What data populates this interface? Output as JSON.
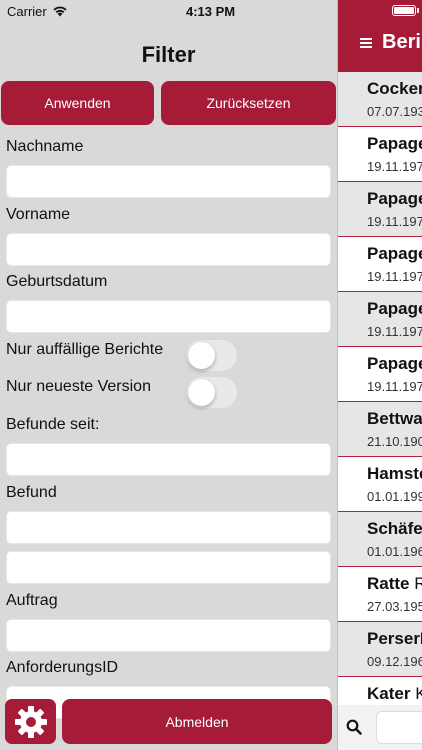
{
  "status_bar": {
    "carrier": "Carrier",
    "time": "4:13 PM"
  },
  "filter": {
    "title": "Filter",
    "apply_label": "Anwenden",
    "reset_label": "Zurücksetzen",
    "fields": {
      "nachname": {
        "label": "Nachname",
        "value": ""
      },
      "vorname": {
        "label": "Vorname",
        "value": ""
      },
      "geburtsdatum": {
        "label": "Geburtsdatum",
        "value": ""
      },
      "befunde_seit": {
        "label": "Befunde seit:",
        "value": ""
      },
      "befund": {
        "label": "Befund",
        "value": "",
        "value2": ""
      },
      "auftrag": {
        "label": "Auftrag",
        "value": ""
      },
      "anforderungs_id": {
        "label": "AnforderungsID",
        "value": ""
      }
    },
    "toggles": {
      "auffaellige": {
        "label": "Nur auffällige Berichte",
        "on": false
      },
      "neueste": {
        "label": "Nur neueste Version",
        "on": false
      }
    },
    "settings_icon": "gear-icon",
    "logout_label": "Abmelden",
    "accent_color": "#a61b38"
  },
  "reports": {
    "title": "Beri",
    "menu_icon": "hamburger-icon",
    "items": [
      {
        "name": "Cocker",
        "suffix": "",
        "date": "07.07.193",
        "alt": true,
        "short": false
      },
      {
        "name": "Papage",
        "suffix": "",
        "date": "19.11.197",
        "alt": false,
        "short": false
      },
      {
        "name": "Papage",
        "suffix": "",
        "date": "19.11.197",
        "alt": true,
        "short": false
      },
      {
        "name": "Papage",
        "suffix": "",
        "date": "19.11.197",
        "alt": false,
        "short": false
      },
      {
        "name": "Papage",
        "suffix": "",
        "date": "19.11.197",
        "alt": true,
        "short": false
      },
      {
        "name": "Papage",
        "suffix": "",
        "date": "19.11.197",
        "alt": false,
        "short": false
      },
      {
        "name": "Bettwa",
        "suffix": "",
        "date": "21.10.190",
        "alt": true,
        "short": false
      },
      {
        "name": "Hamste",
        "suffix": "",
        "date": "01.01.199",
        "alt": false,
        "short": false
      },
      {
        "name": "Schäfe",
        "suffix": "",
        "date": "01.01.196",
        "alt": true,
        "short": false
      },
      {
        "name": "Ratte",
        "suffix": " R",
        "date": "27.03.195",
        "alt": false,
        "short": false
      },
      {
        "name": "PerserI",
        "suffix": "",
        "date": "09.12.196",
        "alt": true,
        "short": false
      },
      {
        "name": "Kater",
        "suffix": " K",
        "date": "",
        "alt": false,
        "short": true
      }
    ],
    "search_icon": "search-icon",
    "search_placeholder": ""
  }
}
